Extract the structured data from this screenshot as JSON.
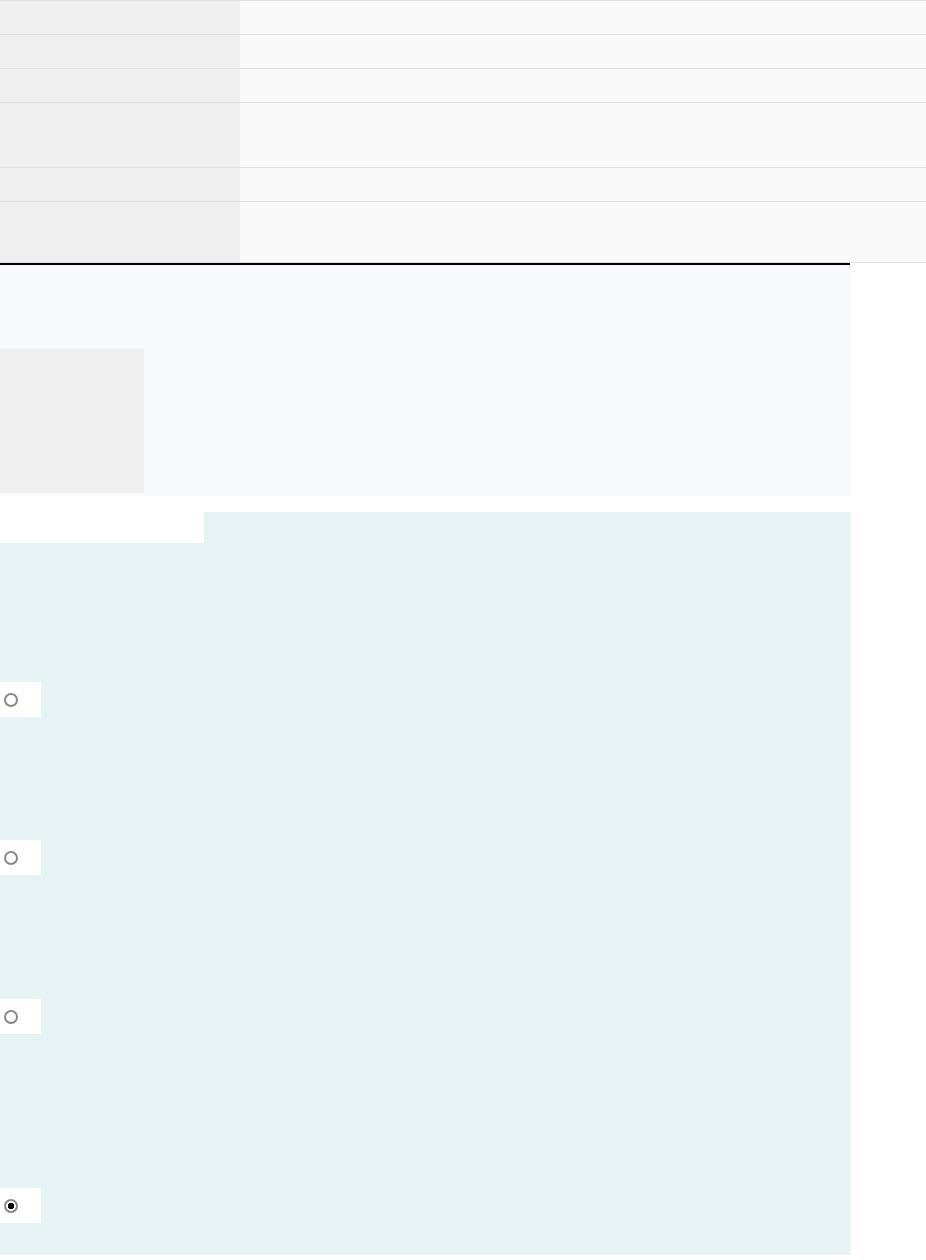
{
  "answer_options": [
    {
      "selected": false
    },
    {
      "selected": false
    },
    {
      "selected": false
    },
    {
      "selected": true
    }
  ]
}
